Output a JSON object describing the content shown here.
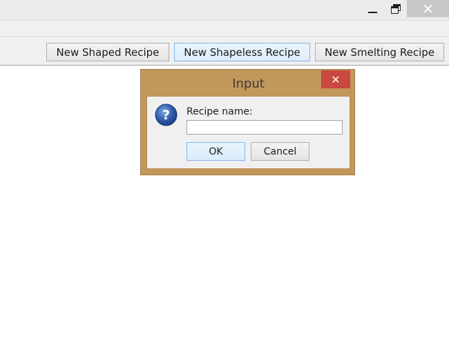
{
  "window": {
    "minimize_icon": "minimize-icon",
    "maximize_icon": "restore-icon",
    "close_icon": "close-icon"
  },
  "toolbar": {
    "buttons": [
      {
        "label": "New Shaped Recipe"
      },
      {
        "label": "New Shapeless Recipe"
      },
      {
        "label": "New Smelting Recipe"
      }
    ]
  },
  "dialog": {
    "title": "Input",
    "close_glyph": "✕",
    "icon": "question-icon",
    "prompt": "Recipe name:",
    "input_value": "",
    "ok_label": "OK",
    "cancel_label": "Cancel"
  },
  "colors": {
    "dialog_frame": "#c1975b",
    "dialog_close": "#c9483f",
    "accent_button": "#7eb4ea"
  }
}
